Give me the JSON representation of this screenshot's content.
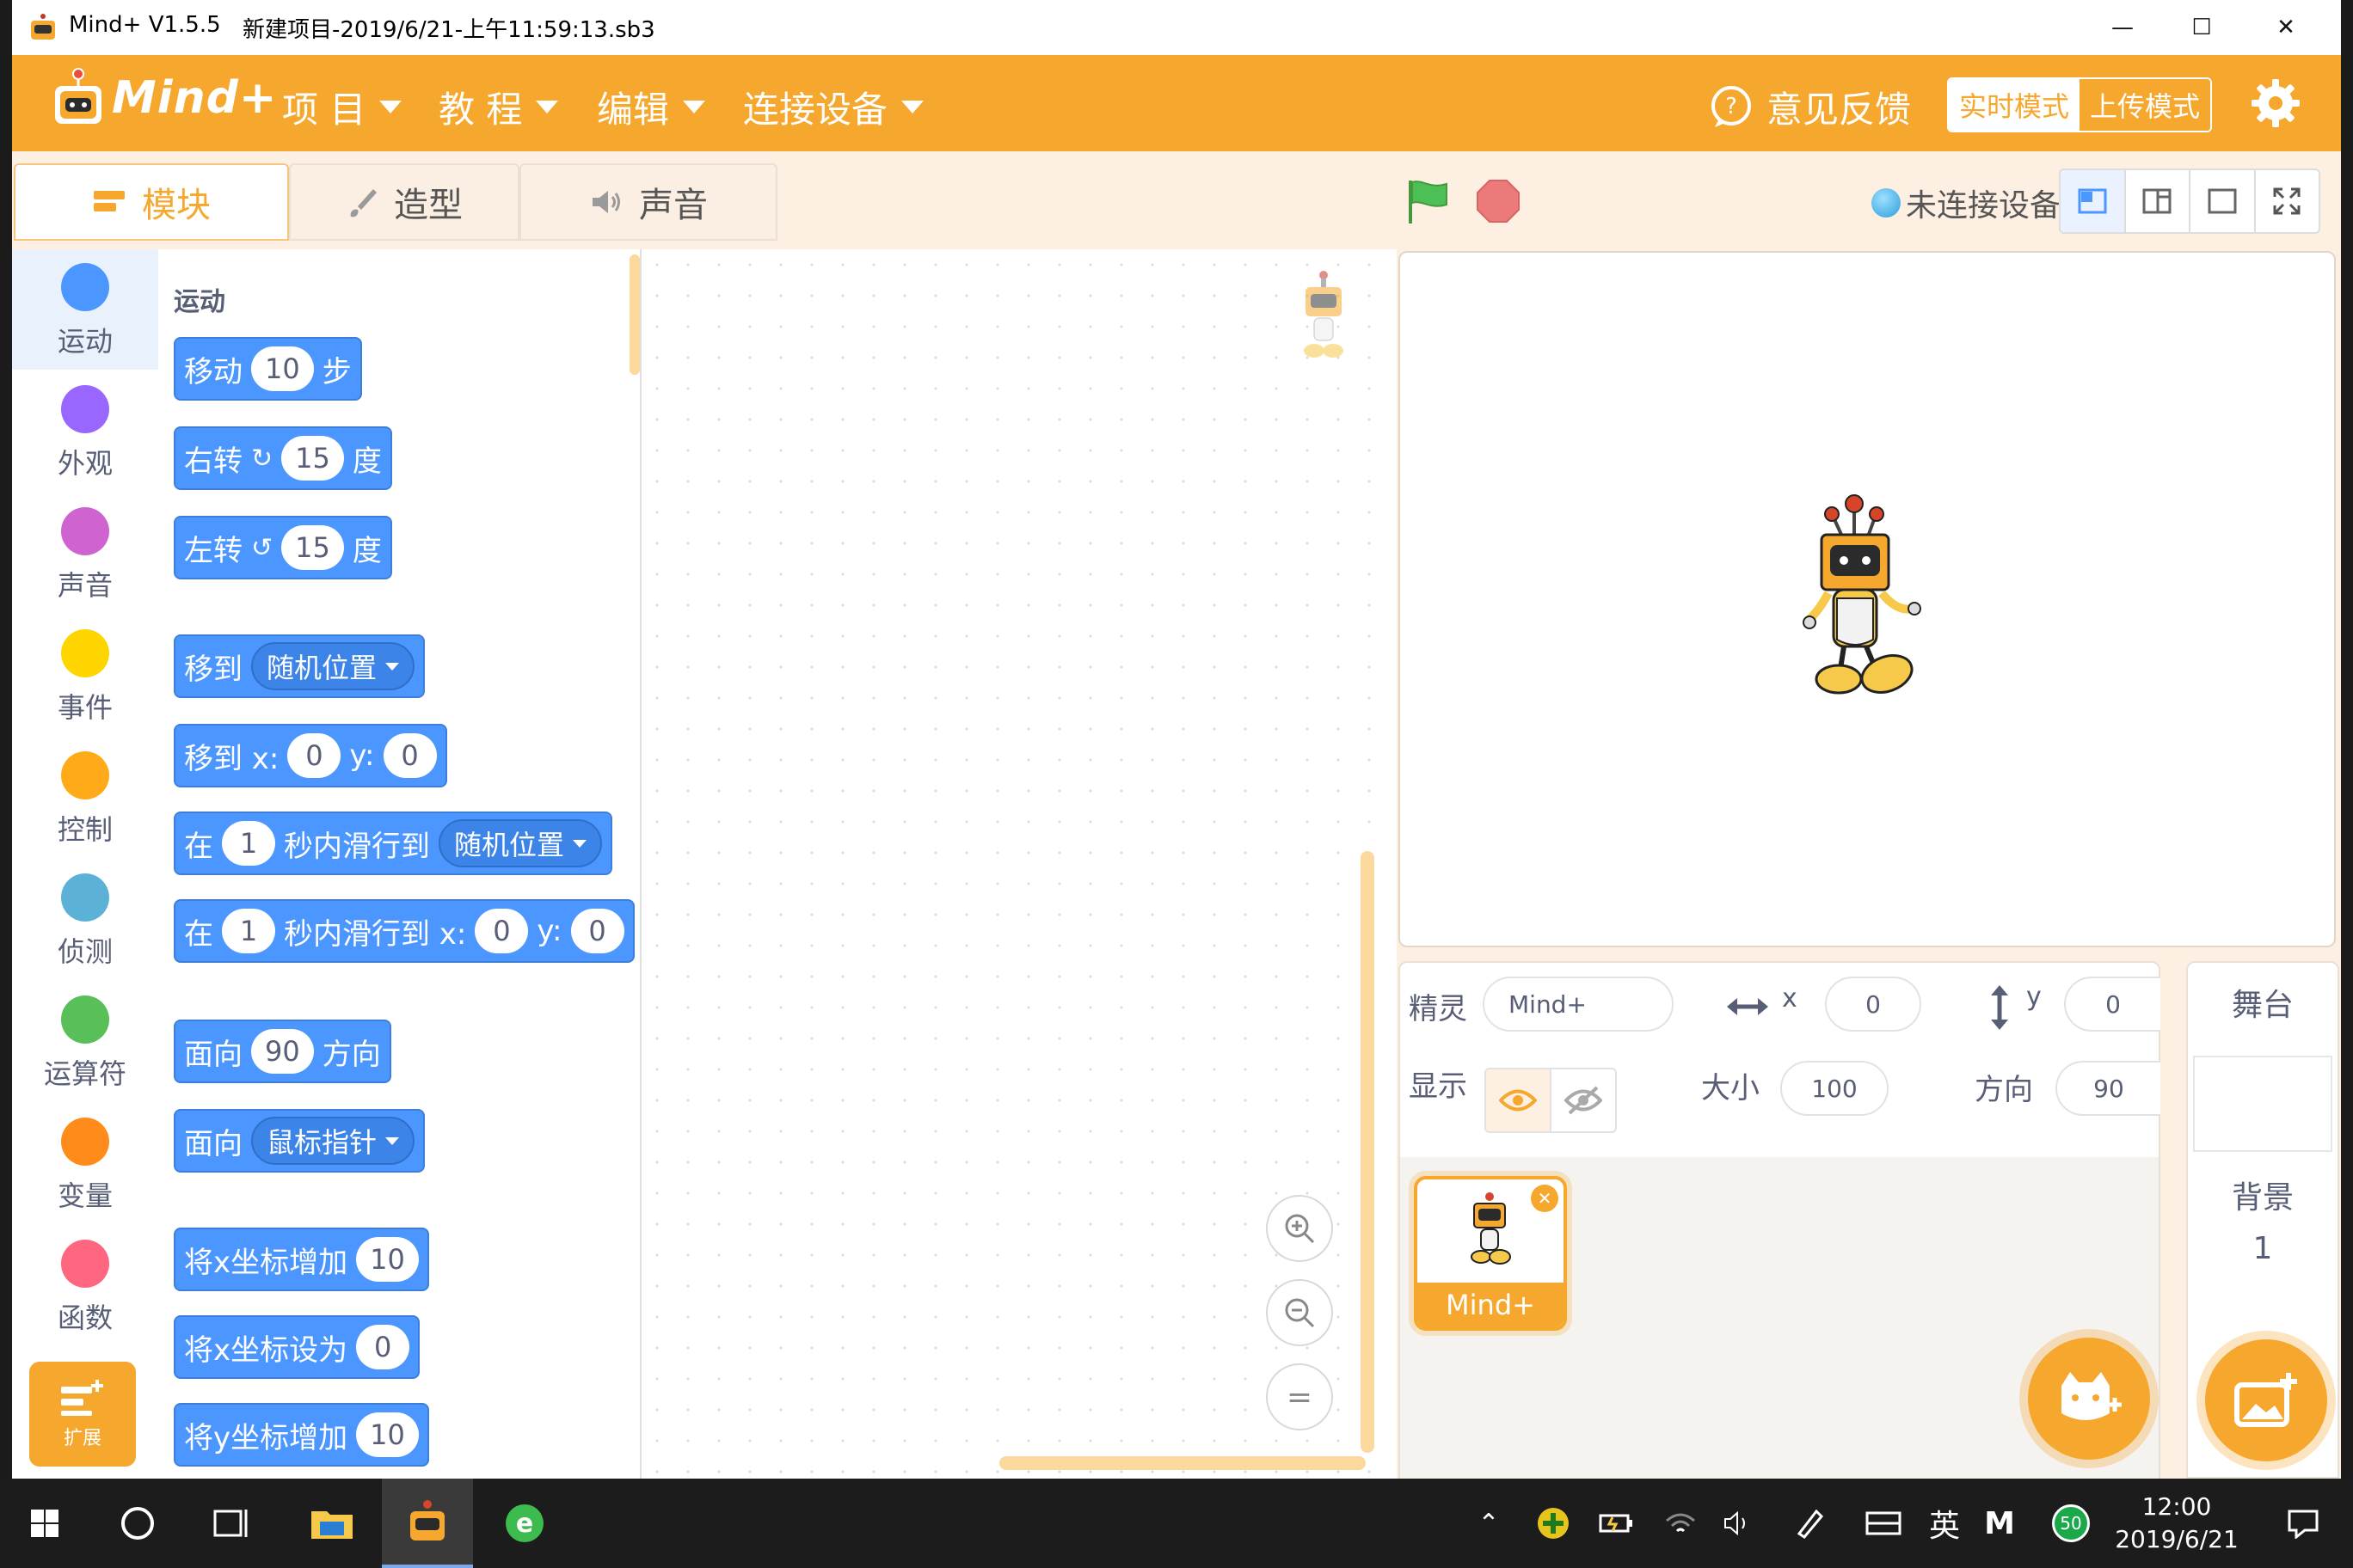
{
  "titlebar": {
    "app": "Mind+ V1.5.5",
    "file": "新建项目-2019/6/21-上午11:59:13.sb3",
    "minimize": "—",
    "maximize": "☐",
    "close": "✕"
  },
  "menubar": {
    "logo": "Mind+",
    "menus": [
      "项 目",
      "教 程",
      "编辑",
      "连接设备"
    ],
    "feedback": "意见反馈",
    "mode_realtime": "实时模式",
    "mode_upload": "上传模式"
  },
  "tabs": {
    "blocks": "模块",
    "costumes": "造型",
    "sounds": "声音"
  },
  "status": {
    "connection": "未连接设备"
  },
  "categories": [
    {
      "label": "运动",
      "color": "#4c97ff"
    },
    {
      "label": "外观",
      "color": "#9966ff"
    },
    {
      "label": "声音",
      "color": "#cf63cf"
    },
    {
      "label": "事件",
      "color": "#ffd500"
    },
    {
      "label": "控制",
      "color": "#ffab19"
    },
    {
      "label": "侦测",
      "color": "#5cb1d6"
    },
    {
      "label": "运算符",
      "color": "#59c059"
    },
    {
      "label": "变量",
      "color": "#ff8c1a"
    },
    {
      "label": "函数",
      "color": "#ff6680"
    }
  ],
  "extensions_label": "扩展",
  "palette": {
    "heading": "运动",
    "blocks": {
      "move": {
        "a": "移动",
        "v": "10",
        "b": "步"
      },
      "turn_right": {
        "a": "右转",
        "v": "15",
        "b": "度"
      },
      "turn_left": {
        "a": "左转",
        "v": "15",
        "b": "度"
      },
      "goto": {
        "a": "移到",
        "d": "随机位置"
      },
      "goto_xy": {
        "a": "移到 x:",
        "x": "0",
        "ylbl": "y:",
        "y": "0"
      },
      "glide": {
        "a": "在",
        "v": "1",
        "b": "秒内滑行到",
        "d": "随机位置"
      },
      "glide_xy": {
        "a": "在",
        "v": "1",
        "b": "秒内滑行到 x:",
        "x": "0",
        "ylbl": "y:",
        "y": "0"
      },
      "point_dir": {
        "a": "面向",
        "v": "90",
        "b": "方向"
      },
      "point_towards": {
        "a": "面向",
        "d": "鼠标指针"
      },
      "change_x": {
        "a": "将x坐标增加",
        "v": "10"
      },
      "set_x": {
        "a": "将x坐标设为",
        "v": "0"
      },
      "change_y": {
        "a": "将y坐标增加",
        "v": "10"
      }
    }
  },
  "zoom": {
    "in": "+",
    "out": "−",
    "reset": "="
  },
  "sprite_info": {
    "sprite_label": "精灵",
    "sprite_name": "Mind+",
    "x_label": "x",
    "x": "0",
    "y_label": "y",
    "y": "0",
    "show_label": "显示",
    "size_label": "大小",
    "size": "100",
    "direction_label": "方向",
    "direction": "90"
  },
  "sprite_list": [
    {
      "name": "Mind+"
    }
  ],
  "stage_panel": {
    "title": "舞台",
    "backdrop_label": "背景",
    "backdrop_count": "1"
  },
  "taskbar": {
    "ime": "英",
    "ime2": "M",
    "badge": "50",
    "time": "12:00",
    "date": "2019/6/21"
  },
  "colors": {
    "accent": "#f6a72e",
    "motion_block": "#4c97ff",
    "green_flag": "#4cbf56",
    "stop": "#ec7a7a"
  }
}
